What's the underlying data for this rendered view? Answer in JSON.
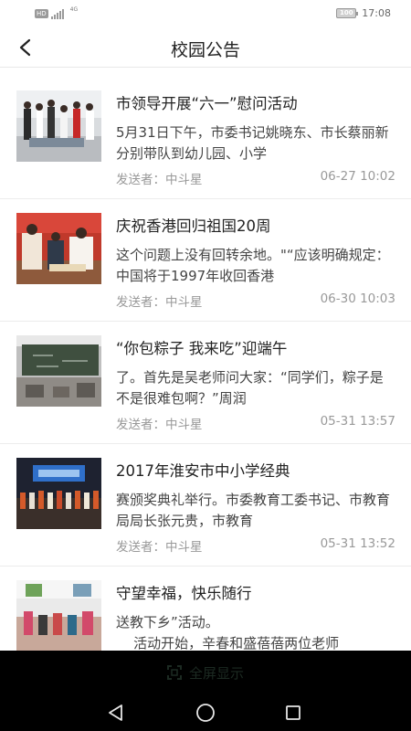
{
  "status_bar": {
    "hd_label": "HD",
    "network_label": "4G",
    "battery": "100",
    "time": "17:08"
  },
  "header": {
    "title": "校园公告",
    "back_icon": "chevron-left-icon"
  },
  "sender_prefix": "发送者：",
  "announcements": [
    {
      "title": "市领导开展“六一”慰问活动",
      "summary": "5月31日下午，市委书记姚晓东、市长蔡丽新分别带队到幼儿园、小学",
      "sender": "发送者：中斗星",
      "time": "06-27 10:02"
    },
    {
      "title": "庆祝香港回归祖国20周",
      "summary": "这个问题上没有回转余地。\"“应该明确规定：中国将于1997年收回香港",
      "sender": "发送者：中斗星",
      "time": "06-30 10:03"
    },
    {
      "title": "“你包粽子 我来吃”迎端午",
      "summary": "了。首先是吴老师问大家：“同学们，粽子是不是很难包啊？”周润",
      "sender": "发送者：中斗星",
      "time": "05-31 13:57"
    },
    {
      "title": "2017年淮安市中小学经典",
      "summary": "赛颁奖典礼举行。市委教育工委书记、市教育局局长张元贵，市教育",
      "sender": "发送者：中斗星",
      "time": "05-31 13:52"
    },
    {
      "title": "守望幸福，快乐随行",
      "summary": "送教下乡”活动。\n    活动开始，辛春和盛蓓蓓两位老师",
      "sender": "",
      "time": ""
    }
  ],
  "fullscreen_bar": {
    "label": "全屏显示",
    "icon": "fullscreen-icon"
  },
  "nav_bar": {
    "back_icon": "triangle-back-icon",
    "home_icon": "circle-home-icon",
    "recents_icon": "square-recents-icon"
  },
  "colors": {
    "background": "#ffffff",
    "text_primary": "#222222",
    "text_secondary": "#444444",
    "text_meta": "#999999",
    "divider": "#ececec",
    "nav_background": "#000000"
  }
}
